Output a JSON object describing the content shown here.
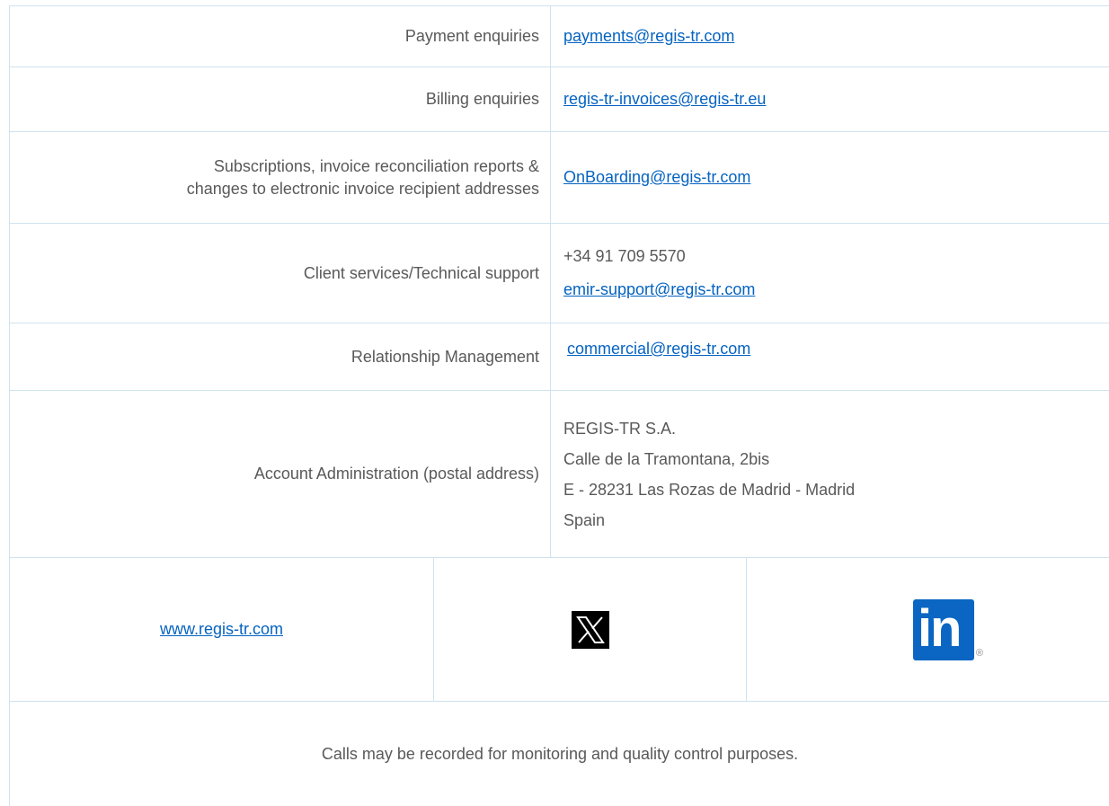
{
  "contacts": [
    {
      "label": "Payment enquiries",
      "email": "payments@regis-tr.com"
    },
    {
      "label": "Billing enquiries",
      "email": "regis-tr-invoices@regis-tr.eu"
    },
    {
      "label_line1": "Subscriptions, invoice reconciliation reports &",
      "label_line2": "changes to electronic invoice recipient addresses",
      "email": "OnBoarding@regis-tr.com"
    },
    {
      "label": "Client services/Technical support",
      "phone": "+34 91 709 5570",
      "email": "emir-support@regis-tr.com"
    },
    {
      "label": "Relationship Management",
      "email": "commercial@regis-tr.com"
    }
  ],
  "postal": {
    "label": "Account Administration (postal address)",
    "lines": [
      "REGIS-TR S.A.",
      "Calle de la Tramontana, 2bis",
      "E - 28231 Las Rozas de Madrid - Madrid",
      "Spain"
    ]
  },
  "social": {
    "website": "www.regis-tr.com",
    "x_icon": "x-logo-icon",
    "linkedin_icon": "linkedin-logo-icon",
    "linkedin_text": "in",
    "registered_mark": "®"
  },
  "footer": {
    "note": "Calls may be recorded for monitoring and quality control purposes."
  },
  "colors": {
    "link": "#0563c1",
    "text": "#595959",
    "border": "#cfe3ee",
    "linkedin": "#0a66c2"
  }
}
